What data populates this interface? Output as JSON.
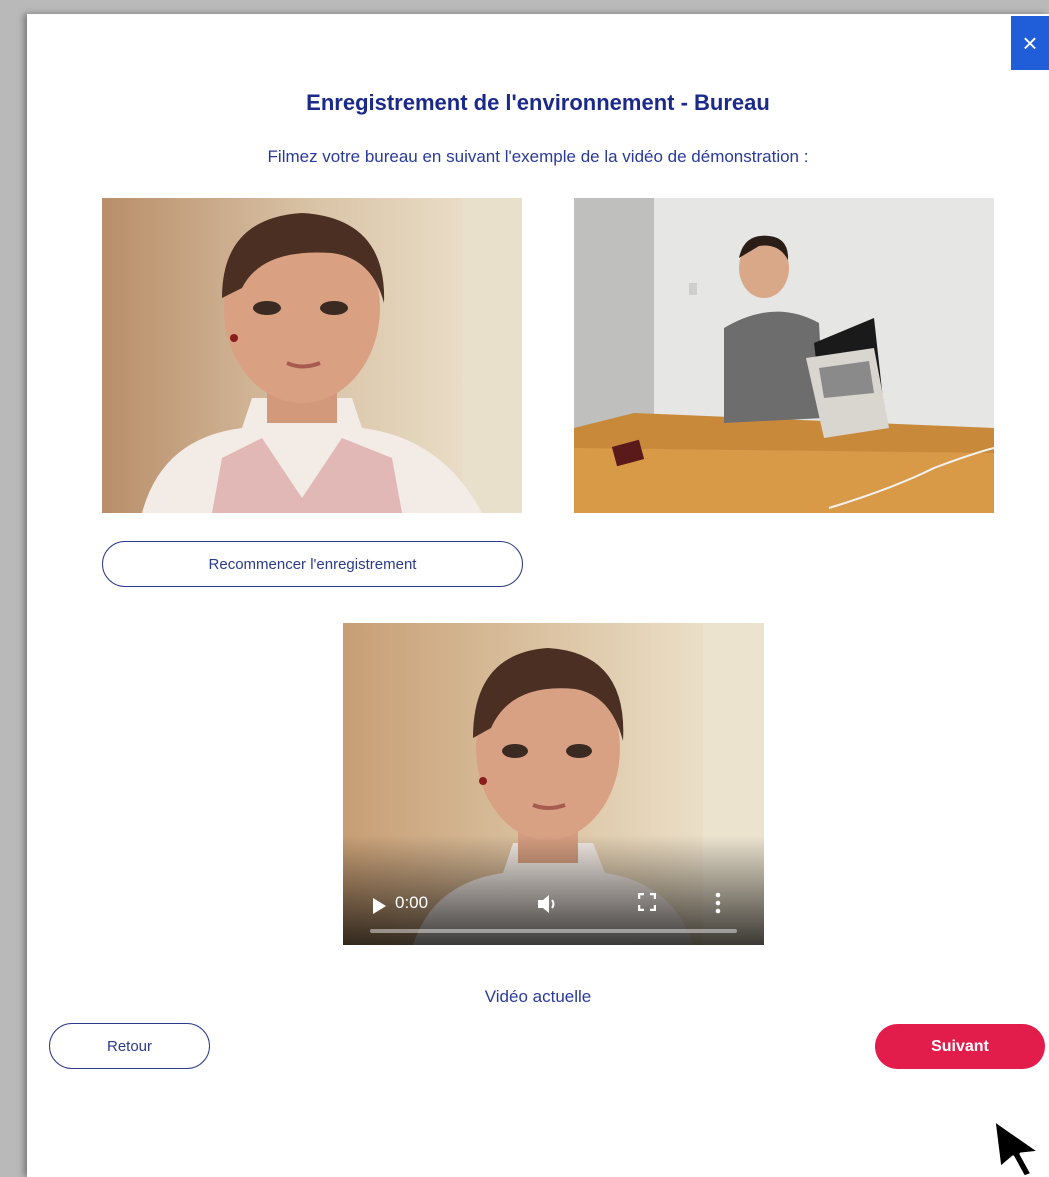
{
  "dialog": {
    "close_label": "×",
    "title": "Enregistrement de l'environnement - Bureau",
    "subtitle": "Filmez votre bureau en suivant l'exemple de la vidéo de démonstration :"
  },
  "recording": {
    "restart_label": "Recommencer l'enregistrement"
  },
  "player": {
    "time": "0:00",
    "progress": 0,
    "caption": "Vidéo actuelle"
  },
  "footer": {
    "back_label": "Retour",
    "next_label": "Suivant"
  },
  "colors": {
    "title": "#1b2a8a",
    "accent_button": "#e31d4b",
    "close_button": "#1f5ed8"
  },
  "icons": [
    "close-icon",
    "play-icon",
    "volume-icon",
    "fullscreen-icon",
    "more-options-icon",
    "mouse-cursor-icon"
  ]
}
